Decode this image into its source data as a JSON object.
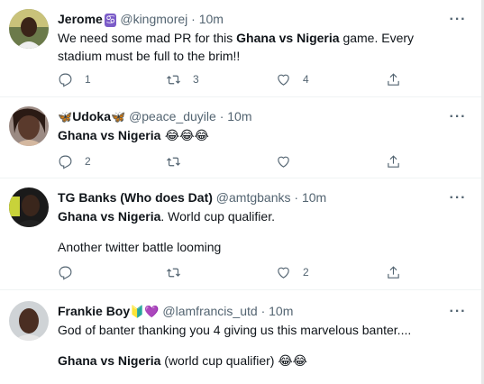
{
  "tweets": [
    {
      "name": "Jerome",
      "name_emoji": "♋",
      "handle": "@kingmorej",
      "sep": "·",
      "time": "10m",
      "text_pre": "We need some mad PR for this ",
      "bold": "Ghana vs Nigeria",
      "text_post": " game. Every stadium must be full to the brim!!",
      "reply_count": "1",
      "retweet_count": "3",
      "like_count": "4"
    },
    {
      "name_prefix_emoji": "🦋",
      "name": "Udoka",
      "name_emoji": "🦋",
      "handle": "@peace_duyile",
      "sep": "·",
      "time": "10m",
      "bold": "Ghana vs Nigeria",
      "text_post": " 😂😂😂",
      "reply_count": "2",
      "retweet_count": "",
      "like_count": ""
    },
    {
      "name": "TG Banks (Who does Dat)",
      "handle": "@amtgbanks",
      "sep": "·",
      "time": "10m",
      "bold": "Ghana vs Nigeria",
      "text_post": ". World cup qualifier.",
      "line2": "Another twitter battle looming",
      "reply_count": "",
      "retweet_count": "",
      "like_count": "2"
    },
    {
      "name": "Frankie Boy",
      "name_emoji": "🔰💜",
      "handle": "@lamfrancis_utd",
      "sep": "·",
      "time": "10m",
      "text_line1": "God of banter thanking you 4 giving us this marvelous banter....",
      "bold": "Ghana vs Nigeria",
      "text_post": " (world cup qualifier) 😂😂"
    }
  ],
  "icons": {
    "more": "more-horizontal-icon",
    "reply": "reply-icon",
    "retweet": "retweet-icon",
    "like": "heart-icon",
    "share": "share-icon"
  },
  "more_glyph": "···",
  "colors": {
    "text": "#0f1419",
    "muted": "#536471",
    "divider": "#eff3f4"
  }
}
